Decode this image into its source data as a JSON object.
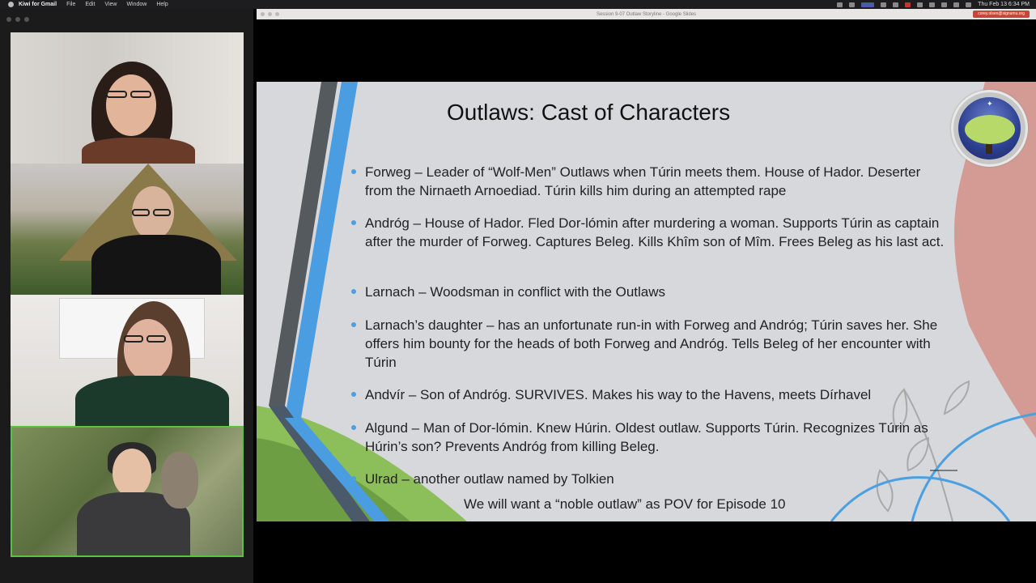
{
  "menubar": {
    "app_name": "Kiwi for Gmail",
    "items": [
      "File",
      "Edit",
      "View",
      "Window",
      "Help"
    ],
    "clock": "Thu Feb 13  6:34 PM"
  },
  "browser": {
    "window_title": "Session 9-07 Outlaw Storyline - Google Slides",
    "account": "corey.olsen@signumu.org"
  },
  "slide": {
    "title": "Outlaws: Cast of Characters",
    "bullets": [
      "Forweg – Leader of “Wolf-Men” Outlaws when Túrin meets them.  House of Hador.  Deserter from the Nirnaeth Arnoediad.  Túrin kills him during an attempted rape",
      "Andróg – House of Hador.  Fled Dor-lómin after murdering a woman.  Supports Túrin as captain after the murder of Forweg.  Captures Beleg.   Kills Khîm son of Mîm.  Frees Beleg as his last act.",
      "Larnach – Woodsman in conflict with the Outlaws",
      "Larnach’s daughter – has an unfortunate run-in with Forweg and Andróg; Túrin saves her.  She offers him bounty for the heads of both Forweg and Andróg.  Tells Beleg of her encounter with Túrin",
      "Andvír – Son of Andróg.  SURVIVES.  Makes his way to the Havens, meets Dírhavel",
      "Algund – Man of Dor-lómin.  Knew Húrin.  Oldest outlaw.  Supports Túrin.  Recognizes Túrin as Húrin’s son?  Prevents Andróg from killing Beleg.",
      "Ulrad – another outlaw named by Tolkien"
    ],
    "footer_note": "We will want a “noble outlaw” as POV for Episode 10"
  },
  "colors": {
    "slide_bg": "#d6d8dc",
    "accent_blue": "#4aa0e0",
    "accent_green": "#8cbf5a",
    "accent_pink": "#d39b93",
    "active_speaker": "#5fbf3f"
  }
}
